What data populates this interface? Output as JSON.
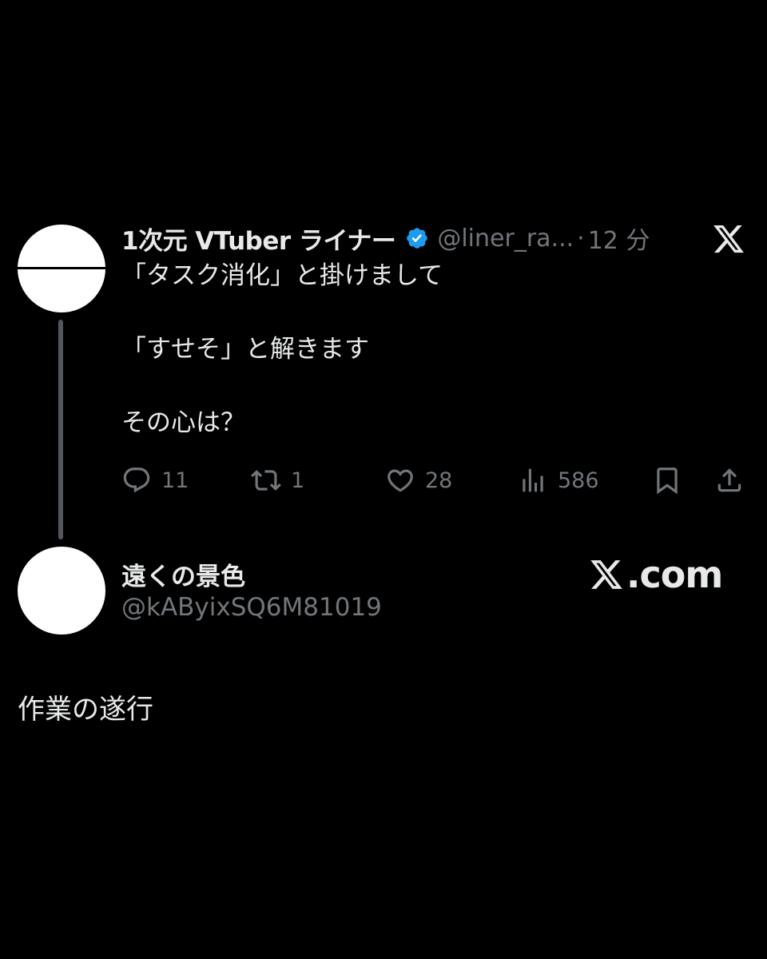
{
  "tweet": {
    "display_name": "1次元 VTuber ライナー",
    "handle": "@liner_ra...",
    "separator": "·",
    "time": "12 分",
    "lines": [
      "「タスク消化」と掛けまして",
      "",
      "「すせそ」と解きます",
      "",
      "その心は？"
    ],
    "verified_color": "#1d9bf0",
    "actions": {
      "reply_count": "11",
      "retweet_count": "1",
      "like_count": "28",
      "views_count": "586"
    }
  },
  "reply": {
    "display_name": "遠くの景色",
    "handle": "@kAByixSQ6M81019",
    "text": "作業の遂行",
    "watermark": ".com"
  },
  "colors": {
    "background": "#000000",
    "text": "#e7e9ea",
    "secondary": "#71767b",
    "thread_line": "#53575b"
  }
}
